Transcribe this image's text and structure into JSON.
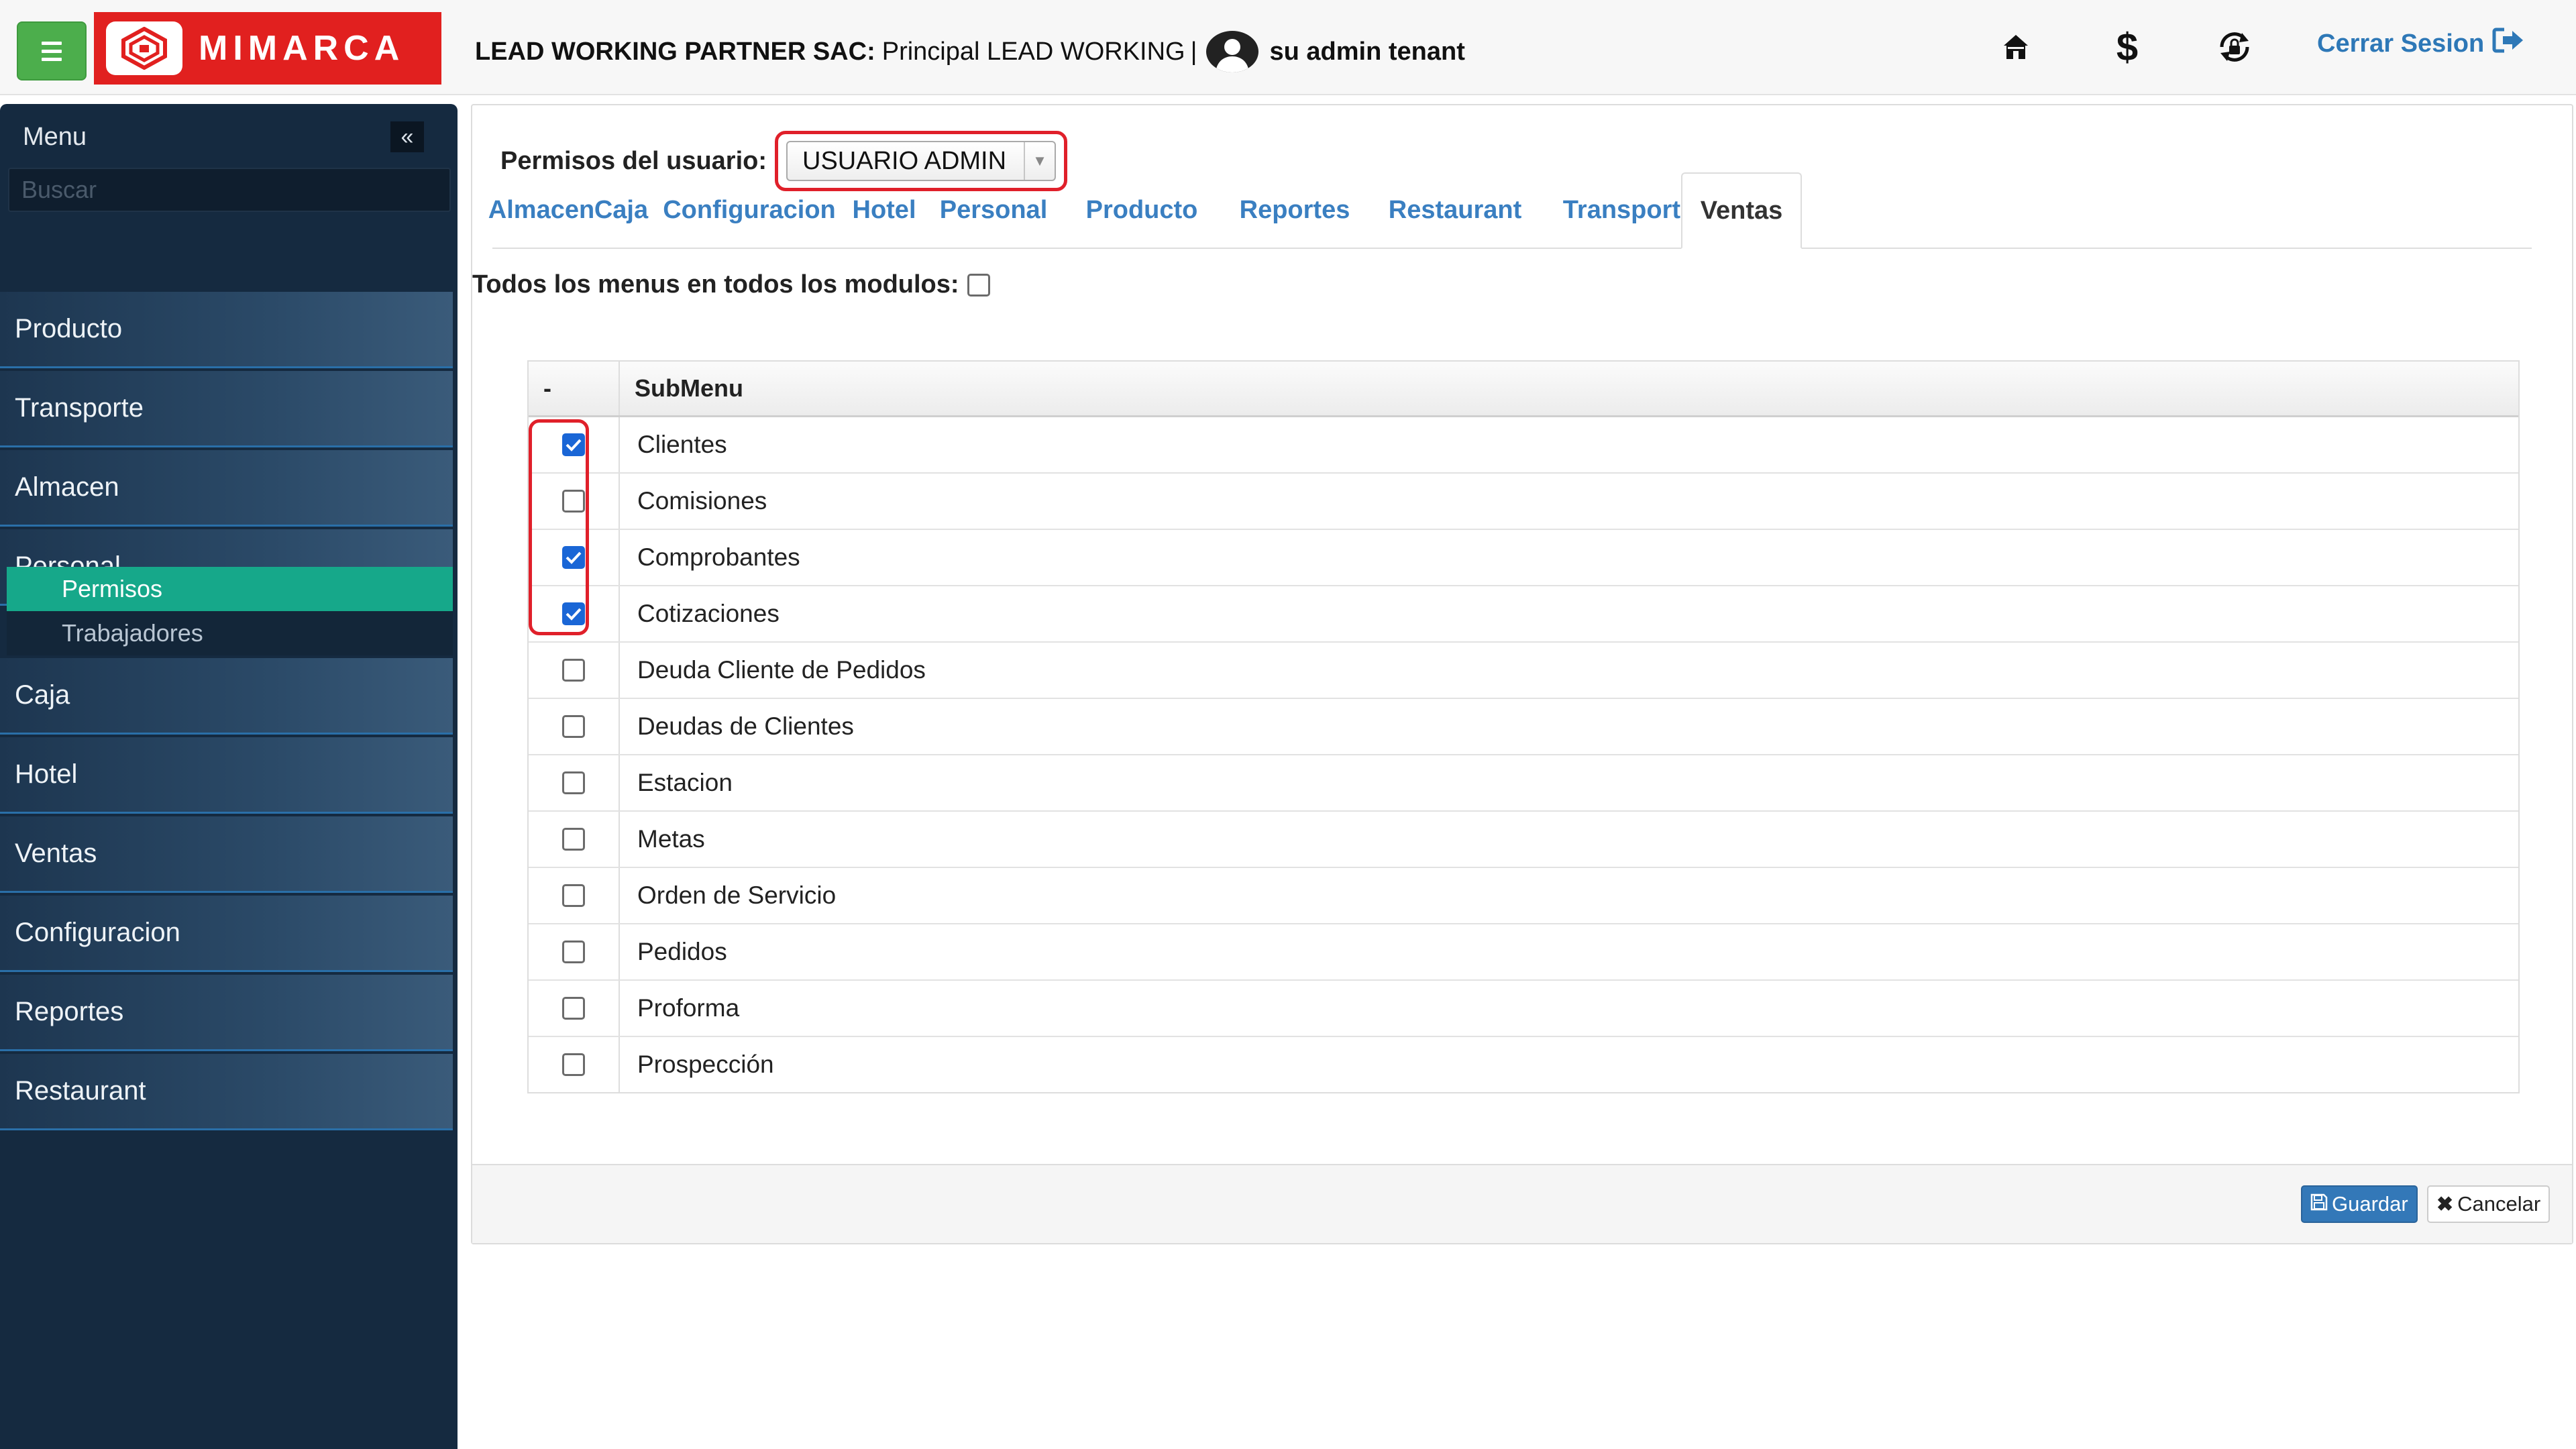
{
  "header": {
    "logo_text": "MIMARCA",
    "company": "LEAD WORKING PARTNER SAC:",
    "branch": "Principal LEAD WORKING",
    "separator": "|",
    "username": "su admin tenant",
    "logout_label": "Cerrar Sesion",
    "icons": [
      "home-icon",
      "dollar-icon",
      "lock-refresh-icon",
      "sign-out-icon"
    ]
  },
  "sidebar": {
    "title": "Menu",
    "collapse_glyph": "«",
    "search_placeholder": "Buscar",
    "items": [
      {
        "label": "Producto"
      },
      {
        "label": "Transporte"
      },
      {
        "label": "Almacen"
      },
      {
        "label": "Personal"
      },
      {
        "label": "Caja"
      },
      {
        "label": "Hotel"
      },
      {
        "label": "Ventas"
      },
      {
        "label": "Configuracion"
      },
      {
        "label": "Reportes"
      },
      {
        "label": "Restaurant"
      }
    ],
    "personal_submenu": [
      {
        "label": "Permisos",
        "active": true
      },
      {
        "label": "Trabajadores",
        "active": false
      }
    ]
  },
  "main": {
    "permissions_label": "Permisos del usuario:",
    "selected_user": "USUARIO ADMIN",
    "tabs": [
      {
        "label": "Almacen"
      },
      {
        "label": "Caja"
      },
      {
        "label": "Configuracion"
      },
      {
        "label": "Hotel"
      },
      {
        "label": "Personal"
      },
      {
        "label": "Producto"
      },
      {
        "label": "Reportes"
      },
      {
        "label": "Restaurant"
      },
      {
        "label": "Transporte"
      },
      {
        "label": "Ventas",
        "active": true
      }
    ],
    "all_menus_label": "Todos los menus en todos los modulos:",
    "all_menus_checked": false,
    "table": {
      "col_check": "-",
      "col_submenu": "SubMenu",
      "rows": [
        {
          "name": "Clientes",
          "checked": true
        },
        {
          "name": "Comisiones",
          "checked": false
        },
        {
          "name": "Comprobantes",
          "checked": true
        },
        {
          "name": "Cotizaciones",
          "checked": true
        },
        {
          "name": "Deuda Cliente de Pedidos",
          "checked": false
        },
        {
          "name": "Deudas de Clientes",
          "checked": false
        },
        {
          "name": "Estacion",
          "checked": false
        },
        {
          "name": "Metas",
          "checked": false
        },
        {
          "name": "Orden de Servicio",
          "checked": false
        },
        {
          "name": "Pedidos",
          "checked": false
        },
        {
          "name": "Proforma",
          "checked": false
        },
        {
          "name": "Prospección",
          "checked": false
        }
      ]
    },
    "save_label": "Guardar",
    "cancel_label": "Cancelar"
  },
  "colors": {
    "accent_blue": "#3a7fc1",
    "sidebar_bg": "#152a40",
    "active_submenu": "#16a88a",
    "highlight_red": "#e0202a",
    "logo_red": "#e1201f",
    "menu_button_green": "#4cae4c"
  }
}
